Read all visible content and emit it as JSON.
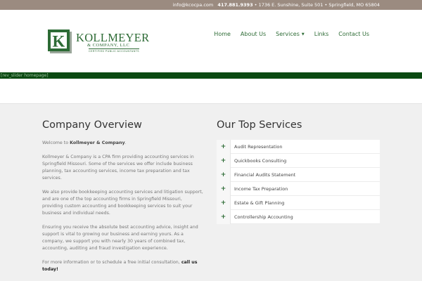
{
  "topbar": {
    "email": "info@kcocpa.com",
    "phone": "417.881.9393",
    "address": "• 1736 E. Sunshine, Suite 501 • Springfield, MO 65804"
  },
  "logo": {
    "letter": "K",
    "name": "KOLLMEYER",
    "sub": "& COMPANY, LLC",
    "tagline": "CERTIFIED PUBLIC ACCOUNTANTS"
  },
  "nav": {
    "home": "Home",
    "about": "About Us",
    "services": "Services",
    "links": "Links",
    "contact": "Contact Us"
  },
  "slider": {
    "text": "[rev_slider homepage]"
  },
  "overview": {
    "title": "Company Overview",
    "welcome_prefix": "Welcome to ",
    "welcome_bold": "Kollmeyer & Company",
    "welcome_suffix": ".",
    "p1": "Kollmeyer & Company is a CPA firm providing accounting services in Springfield Missouri. Some of the services we offer include business planning, tax accounting services, income tax preparation and tax services.",
    "p2": "We also provide bookkeeping accounting services and litigation support, and are one of the top accounting firms in Springfield Missouri, providing custom accounting and bookkeeping services to suit your business and individual needs.",
    "p3": "Ensuring you receive the absolute best accounting advice, insight and support is vital to growing our business and earning yours. As a company, we support you with nearly 30 years of combined tax, accounting, auditing and fraud investigation experience.",
    "p4_prefix": "For more information or to schedule a free initial consultation, ",
    "p4_bold": "call us today!"
  },
  "services": {
    "title": "Our Top Services",
    "plus": "+",
    "items": [
      "Audit Representation",
      "Quickbooks Consulting",
      "Financial Audits Statement",
      "Income Tax Preparation",
      "Estate & Gift Planning",
      "Controllership Accounting"
    ]
  },
  "colors": {
    "brand_green": "#2d6b35",
    "topbar": "#9b8b80",
    "slider": "#0b4a12"
  }
}
